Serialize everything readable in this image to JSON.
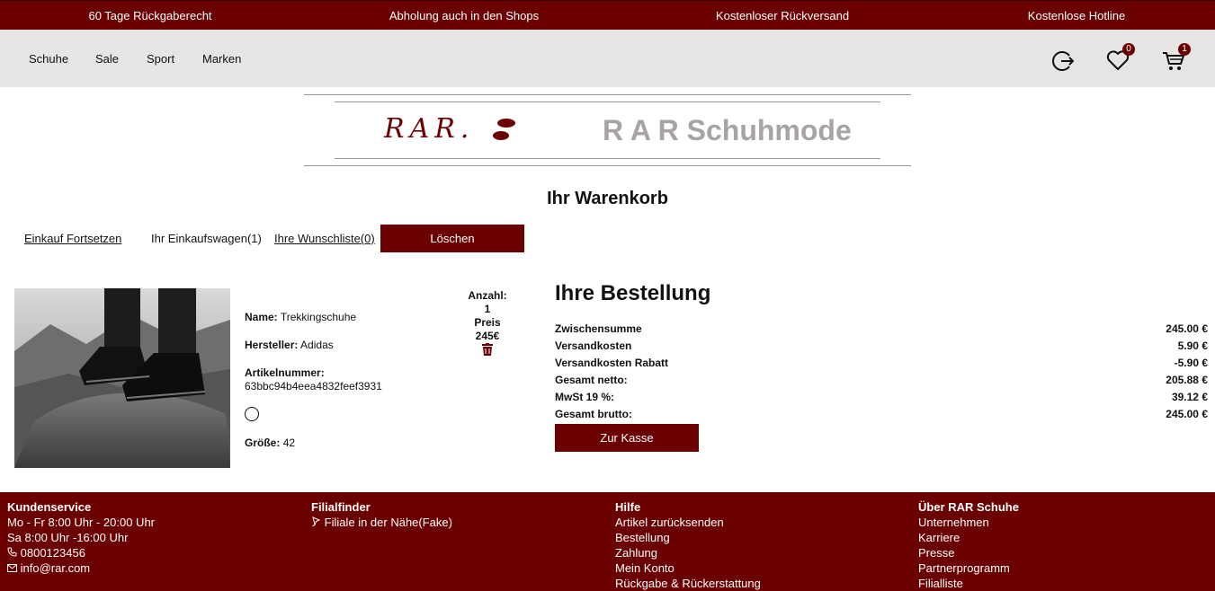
{
  "topbar": {
    "items": [
      "60 Tage Rückgaberecht",
      "Abholung auch in den Shops",
      "Kostenloser Rückversand",
      "Kostenlose Hotline"
    ]
  },
  "nav": {
    "items": [
      "Schuhe",
      "Sale",
      "Sport",
      "Marken"
    ],
    "wishlist_count": "0",
    "cart_count": "1"
  },
  "logo": {
    "mark": "RAR.",
    "text": "R A R Schuhmode"
  },
  "cart": {
    "title": "Ihr Warenkorb",
    "continue_link": "Einkauf Fortsetzen",
    "cart_label": "Ihr Einkaufswagen(1)",
    "wishlist_link": "Ihre Wunschliste(0)",
    "delete_button": "Löschen"
  },
  "product": {
    "name_label": "Name:",
    "name": "Trekkingschuhe",
    "maker_label": "Hersteller:",
    "maker": "Adidas",
    "article_label": "Artikelnummer:",
    "article": "63bbc94b4eea4832feef3931",
    "size_label": "Größe:",
    "size": "42",
    "qty_label": "Anzahl:",
    "qty": "1",
    "price_label": "Preis",
    "price": "245€"
  },
  "order": {
    "title": "Ihre Bestellung",
    "rows": [
      {
        "label": "Zwischensumme",
        "value": "245.00 €"
      },
      {
        "label": "Versandkosten",
        "value": "5.90 €"
      },
      {
        "label": "Versandkosten Rabatt",
        "value": "-5.90 €"
      },
      {
        "label": "Gesamt netto:",
        "value": "205.88 €"
      },
      {
        "label": "MwSt 19 %:",
        "value": "39.12 €"
      },
      {
        "label": "Gesamt brutto:",
        "value": "245.00 €"
      }
    ],
    "checkout_button": "Zur Kasse"
  },
  "footer": {
    "service": {
      "title": "Kundenservice",
      "hours1": "Mo - Fr 8:00 Uhr - 20:00 Uhr",
      "hours2": "Sa 8:00 Uhr -16:00 Uhr",
      "phone": "0800123456",
      "email": "info@rar.com"
    },
    "finder": {
      "title": "Filialfinder",
      "link": "Filiale in der Nähe(Fake)"
    },
    "help": {
      "title": "Hilfe",
      "links": [
        "Artikel zurücksenden",
        "Bestellung",
        "Zahlung",
        "Mein Konto",
        "Rückgabe & Rückerstattung"
      ]
    },
    "about": {
      "title": "Über RAR Schuhe",
      "links": [
        "Unternehmen",
        "Karriere",
        "Presse",
        "Partnerprogramm",
        "Filialliste"
      ]
    }
  },
  "colors": {
    "brand": "#6b0000",
    "nav_bg": "#e7e4e4",
    "logo_grey": "#a8a4a4"
  }
}
